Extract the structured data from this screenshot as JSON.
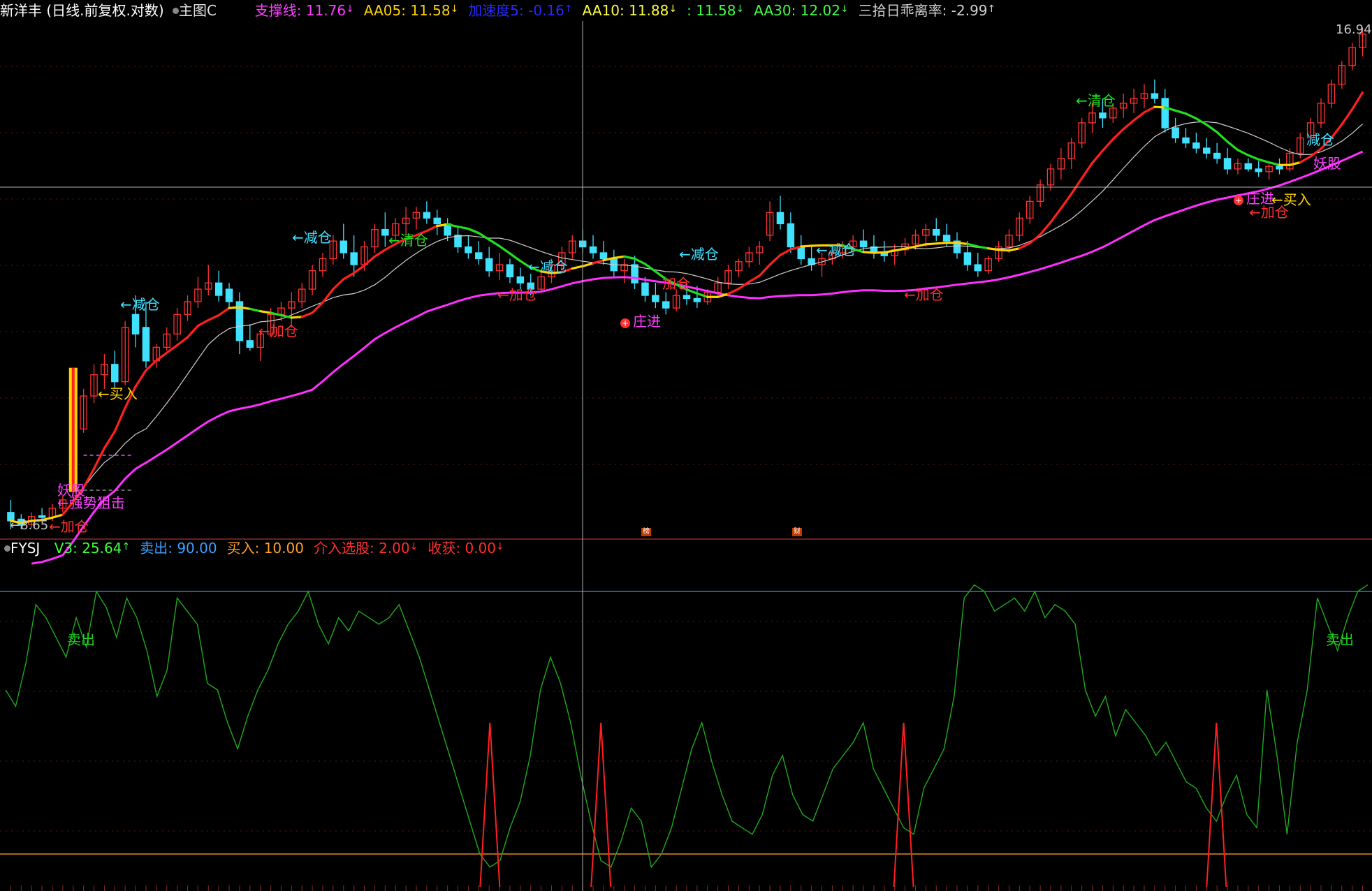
{
  "main_header": {
    "stock": "新洋丰 (日线.前复权.对数)",
    "template": "主图C",
    "indicators": [
      {
        "label": "支撑线: ",
        "value": "11.76",
        "arrow": "↓",
        "color": "#ff40ff"
      },
      {
        "label": "AA05: ",
        "value": "11.58",
        "arrow": "↓",
        "color": "#ffd400"
      },
      {
        "label": "加速度5: ",
        "value": "-0.16",
        "arrow": "↑",
        "color": "#2a2aff"
      },
      {
        "label": "AA10: ",
        "value": "11.88",
        "arrow": "↓",
        "color": "#ffff40"
      },
      {
        "label": ": ",
        "value": "11.58",
        "arrow": "↓",
        "color": "#40ff40"
      },
      {
        "label": "AA30: ",
        "value": "12.02",
        "arrow": "↓",
        "color": "#40ff40"
      },
      {
        "label": "三拾日乖离率: ",
        "value": "-2.99",
        "arrow": "↑",
        "color": "#d0d0d0"
      }
    ]
  },
  "sub_header": {
    "name": "FYSJ",
    "indicators": [
      {
        "label": "V3: ",
        "value": "25.64",
        "arrow": "↑",
        "color": "#40ff40"
      },
      {
        "label": "卖出: ",
        "value": "90.00",
        "arrow": "",
        "color": "#3fa0ff"
      },
      {
        "label": "买入: ",
        "value": "10.00",
        "arrow": "",
        "color": "#ffa030"
      },
      {
        "label": "介入选股: ",
        "value": "2.00",
        "arrow": "↓",
        "color": "#ff3030"
      },
      {
        "label": "收获: ",
        "value": "0.00",
        "arrow": "↓",
        "color": "#ff3030"
      }
    ]
  },
  "price_labels": {
    "high": "16.94",
    "low": "8.65"
  },
  "event_markers": [
    "榜",
    "财"
  ],
  "colors": {
    "up": "#ff3232",
    "down": "#40e0ff",
    "support": "#ff30ff",
    "aa10_up": "#ff2020",
    "aa10_mid": "#ffd400",
    "aa10_down": "#20e020",
    "aa30": "#cfcfcf",
    "osc": "#1faa1f",
    "spike": "#ff2020"
  },
  "annotations": [
    {
      "text": "←买入",
      "color": "#ffd400"
    },
    {
      "text": "←减仓",
      "color": "#40e0ff"
    },
    {
      "text": "←加仓",
      "color": "#ff3030"
    },
    {
      "text": "←减仓",
      "color": "#40e0ff"
    },
    {
      "text": "←清仓",
      "color": "#20e020"
    },
    {
      "text": "←加仓",
      "color": "#ff3030"
    },
    {
      "text": "←减仓",
      "color": "#40e0ff"
    },
    {
      "text": "庄进",
      "color": "#ff40ff"
    },
    {
      "text": "←减仓",
      "color": "#40e0ff"
    },
    {
      "text": "加仓",
      "color": "#ff3030"
    },
    {
      "text": "←减仓",
      "color": "#40e0ff"
    },
    {
      "text": "←加仓",
      "color": "#ff3030"
    },
    {
      "text": "←清仓",
      "color": "#20e020"
    },
    {
      "text": "减仓",
      "color": "#40e0ff"
    },
    {
      "text": "妖股",
      "color": "#ff40ff"
    },
    {
      "text": "庄进",
      "color": "#ff40ff"
    },
    {
      "text": "←买入",
      "color": "#ffd400"
    },
    {
      "text": "←加仓",
      "color": "#ff3030"
    },
    {
      "text": "妖股",
      "color": "#ff40ff"
    },
    {
      "text": "←强势狙击",
      "color": "#ff40ff"
    },
    {
      "text": "←加仓",
      "color": "#ff3030"
    },
    {
      "text": "卖出",
      "color": "#20d020"
    },
    {
      "text": "卖出",
      "color": "#20d020"
    }
  ],
  "chart_data": [
    {
      "type": "candlestick",
      "title": "新洋丰 (日线.前复权.对数)",
      "scale": "log",
      "ylim": [
        8.65,
        16.94
      ],
      "candles": [
        [
          8.8,
          8.95,
          8.6,
          8.7
        ],
        [
          8.72,
          8.78,
          8.6,
          8.65
        ],
        [
          8.66,
          8.8,
          8.62,
          8.75
        ],
        [
          8.76,
          8.85,
          8.7,
          8.74
        ],
        [
          8.74,
          8.9,
          8.7,
          8.85
        ],
        [
          8.85,
          9.0,
          8.8,
          8.95
        ],
        [
          9.05,
          9.9,
          9.0,
          9.85
        ],
        [
          9.85,
          10.4,
          9.8,
          10.3
        ],
        [
          10.3,
          10.75,
          10.2,
          10.6
        ],
        [
          10.6,
          10.9,
          10.4,
          10.75
        ],
        [
          10.75,
          10.95,
          10.4,
          10.5
        ],
        [
          10.5,
          11.4,
          10.45,
          11.3
        ],
        [
          11.5,
          11.8,
          11.0,
          11.2
        ],
        [
          11.3,
          11.7,
          10.7,
          10.8
        ],
        [
          10.8,
          11.05,
          10.7,
          11.0
        ],
        [
          11.0,
          11.3,
          10.95,
          11.2
        ],
        [
          11.2,
          11.6,
          11.1,
          11.5
        ],
        [
          11.5,
          11.8,
          11.4,
          11.7
        ],
        [
          11.7,
          12.1,
          11.6,
          11.9
        ],
        [
          11.9,
          12.3,
          11.8,
          12.0
        ],
        [
          12.0,
          12.2,
          11.7,
          11.8
        ],
        [
          11.9,
          12.0,
          11.6,
          11.7
        ],
        [
          11.7,
          11.85,
          10.9,
          11.1
        ],
        [
          11.1,
          11.35,
          10.95,
          11.0
        ],
        [
          11.0,
          11.25,
          10.8,
          11.2
        ],
        [
          11.2,
          11.6,
          11.15,
          11.5
        ],
        [
          11.5,
          11.7,
          11.4,
          11.6
        ],
        [
          11.6,
          11.85,
          11.3,
          11.7
        ],
        [
          11.7,
          12.0,
          11.6,
          11.9
        ],
        [
          11.9,
          12.3,
          11.8,
          12.2
        ],
        [
          12.2,
          12.5,
          12.1,
          12.4
        ],
        [
          12.4,
          12.8,
          12.3,
          12.7
        ],
        [
          12.7,
          13.0,
          12.4,
          12.5
        ],
        [
          12.5,
          12.8,
          12.1,
          12.3
        ],
        [
          12.3,
          12.7,
          12.2,
          12.6
        ],
        [
          12.6,
          13.0,
          12.5,
          12.9
        ],
        [
          12.9,
          13.2,
          12.6,
          12.8
        ],
        [
          12.8,
          13.1,
          12.7,
          13.0
        ],
        [
          13.0,
          13.3,
          12.8,
          13.1
        ],
        [
          13.1,
          13.3,
          12.9,
          13.2
        ],
        [
          13.2,
          13.4,
          13.0,
          13.1
        ],
        [
          13.1,
          13.25,
          12.8,
          13.0
        ],
        [
          13.0,
          13.1,
          12.7,
          12.8
        ],
        [
          12.8,
          12.95,
          12.5,
          12.6
        ],
        [
          12.6,
          12.8,
          12.4,
          12.5
        ],
        [
          12.5,
          12.7,
          12.3,
          12.4
        ],
        [
          12.4,
          12.6,
          12.1,
          12.2
        ],
        [
          12.2,
          12.5,
          12.05,
          12.3
        ],
        [
          12.3,
          12.4,
          12.0,
          12.1
        ],
        [
          12.1,
          12.25,
          11.9,
          12.0
        ],
        [
          12.0,
          12.15,
          11.8,
          11.9
        ],
        [
          11.9,
          12.2,
          11.85,
          12.1
        ],
        [
          12.1,
          12.4,
          12.0,
          12.3
        ],
        [
          12.3,
          12.6,
          12.2,
          12.5
        ],
        [
          12.5,
          12.8,
          12.4,
          12.7
        ],
        [
          12.7,
          12.9,
          12.5,
          12.6
        ],
        [
          12.6,
          12.8,
          12.4,
          12.5
        ],
        [
          12.5,
          12.7,
          12.3,
          12.4
        ],
        [
          12.4,
          12.55,
          12.1,
          12.2
        ],
        [
          12.2,
          12.4,
          12.0,
          12.3
        ],
        [
          12.3,
          12.45,
          11.9,
          12.0
        ],
        [
          12.0,
          12.1,
          11.7,
          11.8
        ],
        [
          11.8,
          12.0,
          11.6,
          11.7
        ],
        [
          11.7,
          11.85,
          11.5,
          11.6
        ],
        [
          11.6,
          11.9,
          11.55,
          11.8
        ],
        [
          11.8,
          12.0,
          11.65,
          11.75
        ],
        [
          11.75,
          11.95,
          11.6,
          11.7
        ],
        [
          11.7,
          11.9,
          11.65,
          11.85
        ],
        [
          11.85,
          12.1,
          11.8,
          12.0
        ],
        [
          12.0,
          12.3,
          11.9,
          12.2
        ],
        [
          12.2,
          12.4,
          12.1,
          12.35
        ],
        [
          12.35,
          12.6,
          12.25,
          12.5
        ],
        [
          12.5,
          12.7,
          12.3,
          12.6
        ],
        [
          12.8,
          13.4,
          12.7,
          13.2
        ],
        [
          13.2,
          13.5,
          12.9,
          13.0
        ],
        [
          13.0,
          13.2,
          12.5,
          12.6
        ],
        [
          12.6,
          12.8,
          12.3,
          12.4
        ],
        [
          12.4,
          12.6,
          12.2,
          12.3
        ],
        [
          12.3,
          12.5,
          12.1,
          12.4
        ],
        [
          12.4,
          12.6,
          12.3,
          12.5
        ],
        [
          12.5,
          12.7,
          12.4,
          12.6
        ],
        [
          12.6,
          12.8,
          12.45,
          12.7
        ],
        [
          12.7,
          12.9,
          12.5,
          12.6
        ],
        [
          12.6,
          12.8,
          12.4,
          12.5
        ],
        [
          12.5,
          12.7,
          12.35,
          12.45
        ],
        [
          12.45,
          12.65,
          12.3,
          12.55
        ],
        [
          12.55,
          12.75,
          12.45,
          12.65
        ],
        [
          12.65,
          12.9,
          12.55,
          12.8
        ],
        [
          12.8,
          13.0,
          12.6,
          12.9
        ],
        [
          12.9,
          13.1,
          12.7,
          12.8
        ],
        [
          12.8,
          13.0,
          12.6,
          12.7
        ],
        [
          12.7,
          12.85,
          12.4,
          12.5
        ],
        [
          12.5,
          12.7,
          12.2,
          12.3
        ],
        [
          12.3,
          12.5,
          12.1,
          12.2
        ],
        [
          12.2,
          12.45,
          12.15,
          12.4
        ],
        [
          12.4,
          12.7,
          12.35,
          12.6
        ],
        [
          12.6,
          12.9,
          12.5,
          12.8
        ],
        [
          12.8,
          13.2,
          12.7,
          13.1
        ],
        [
          13.1,
          13.5,
          13.0,
          13.4
        ],
        [
          13.4,
          13.8,
          13.3,
          13.7
        ],
        [
          13.7,
          14.1,
          13.6,
          14.0
        ],
        [
          14.0,
          14.4,
          13.8,
          14.2
        ],
        [
          14.2,
          14.6,
          14.0,
          14.5
        ],
        [
          14.5,
          15.0,
          14.4,
          14.9
        ],
        [
          14.9,
          15.3,
          14.7,
          15.1
        ],
        [
          15.1,
          15.4,
          14.8,
          15.0
        ],
        [
          15.0,
          15.3,
          14.9,
          15.2
        ],
        [
          15.2,
          15.5,
          15.0,
          15.3
        ],
        [
          15.3,
          15.6,
          15.1,
          15.4
        ],
        [
          15.4,
          15.7,
          15.2,
          15.5
        ],
        [
          15.5,
          15.8,
          15.3,
          15.4
        ],
        [
          15.4,
          15.6,
          14.7,
          14.8
        ],
        [
          14.8,
          15.0,
          14.5,
          14.6
        ],
        [
          14.6,
          14.8,
          14.4,
          14.5
        ],
        [
          14.5,
          14.7,
          14.3,
          14.4
        ],
        [
          14.4,
          14.6,
          14.2,
          14.3
        ],
        [
          14.3,
          14.5,
          14.1,
          14.2
        ],
        [
          14.2,
          14.4,
          13.9,
          14.0
        ],
        [
          14.0,
          14.2,
          13.9,
          14.1
        ],
        [
          14.1,
          14.2,
          13.95,
          14.0
        ],
        [
          14.0,
          14.15,
          13.85,
          13.95
        ],
        [
          13.95,
          14.1,
          13.8,
          14.05
        ],
        [
          14.05,
          14.2,
          13.9,
          14.0
        ],
        [
          14.0,
          14.4,
          13.95,
          14.3
        ],
        [
          14.3,
          14.7,
          14.2,
          14.6
        ],
        [
          14.6,
          15.0,
          14.5,
          14.9
        ],
        [
          14.9,
          15.4,
          14.8,
          15.3
        ],
        [
          15.3,
          15.8,
          15.2,
          15.7
        ],
        [
          15.7,
          16.2,
          15.6,
          16.1
        ],
        [
          16.1,
          16.6,
          16.0,
          16.5
        ],
        [
          16.5,
          16.94,
          16.3,
          16.8
        ]
      ],
      "lines": [
        {
          "name": "支撑线",
          "last": 11.76
        },
        {
          "name": "AA05",
          "last": 11.58
        },
        {
          "name": "AA10",
          "last": 11.88
        },
        {
          "name": "AA30",
          "last": 12.02
        }
      ]
    },
    {
      "type": "line",
      "title": "FYSJ",
      "ylim": [
        0,
        100
      ],
      "hlines": [
        {
          "name": "卖出",
          "value": 90
        },
        {
          "name": "买入",
          "value": 10
        }
      ],
      "series": [
        {
          "name": "V3",
          "values": [
            60,
            55,
            68,
            86,
            82,
            76,
            70,
            82,
            73,
            90,
            85,
            76,
            88,
            82,
            72,
            58,
            66,
            88,
            84,
            80,
            62,
            60,
            50,
            42,
            52,
            60,
            66,
            74,
            80,
            84,
            90,
            80,
            74,
            82,
            78,
            84,
            82,
            80,
            82,
            86,
            78,
            70,
            60,
            50,
            40,
            30,
            20,
            10,
            6,
            8,
            18,
            26,
            40,
            60,
            70,
            62,
            50,
            34,
            20,
            8,
            6,
            14,
            24,
            20,
            6,
            10,
            18,
            30,
            42,
            50,
            38,
            28,
            20,
            18,
            16,
            22,
            34,
            40,
            28,
            22,
            20,
            28,
            36,
            40,
            44,
            50,
            36,
            30,
            24,
            18,
            16,
            30,
            36,
            42,
            58,
            88,
            92,
            90,
            84,
            86,
            88,
            84,
            90,
            82,
            86,
            84,
            80,
            60,
            52,
            58,
            46,
            54,
            50,
            46,
            40,
            44,
            38,
            32,
            30,
            24,
            20,
            28,
            34,
            22,
            18,
            60,
            40,
            16,
            44,
            60,
            88,
            80,
            72,
            82,
            90,
            92
          ]
        },
        {
          "name": "介入选股",
          "values": [
            0,
            0,
            0,
            0,
            0,
            0,
            0,
            0,
            0,
            0,
            0,
            0,
            0,
            0,
            0,
            0,
            0,
            0,
            0,
            0,
            0,
            0,
            0,
            0,
            0,
            0,
            0,
            0,
            0,
            0,
            0,
            0,
            0,
            0,
            0,
            0,
            0,
            0,
            0,
            0,
            0,
            0,
            0,
            0,
            0,
            0,
            0,
            0,
            50,
            0,
            0,
            0,
            0,
            0,
            0,
            0,
            0,
            0,
            0,
            50,
            0,
            0,
            0,
            0,
            0,
            0,
            0,
            0,
            0,
            0,
            0,
            0,
            0,
            0,
            0,
            0,
            0,
            0,
            0,
            0,
            0,
            0,
            0,
            0,
            0,
            0,
            0,
            0,
            0,
            50,
            0,
            0,
            0,
            0,
            0,
            0,
            0,
            0,
            0,
            0,
            0,
            0,
            0,
            0,
            0,
            0,
            0,
            0,
            0,
            0,
            0,
            0,
            0,
            0,
            0,
            0,
            0,
            0,
            0,
            0,
            50,
            0,
            0,
            0,
            0,
            0,
            0,
            0,
            0,
            0,
            0,
            0,
            0,
            0,
            0,
            0,
            0
          ]
        }
      ]
    }
  ]
}
